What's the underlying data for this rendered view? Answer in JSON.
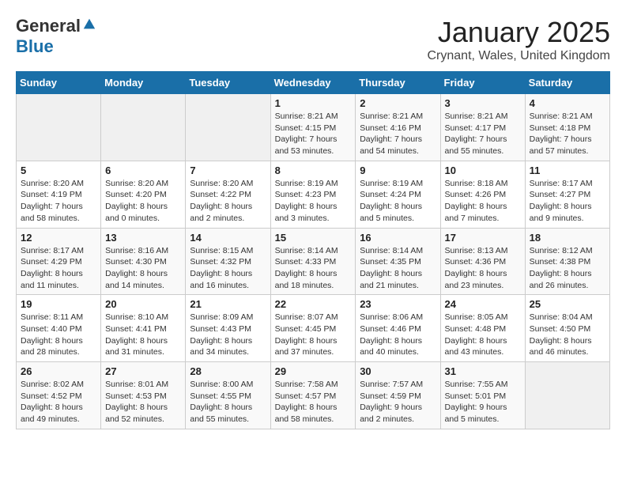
{
  "header": {
    "logo_general": "General",
    "logo_blue": "Blue",
    "title": "January 2025",
    "location": "Crynant, Wales, United Kingdom"
  },
  "days_of_week": [
    "Sunday",
    "Monday",
    "Tuesday",
    "Wednesday",
    "Thursday",
    "Friday",
    "Saturday"
  ],
  "weeks": [
    [
      {
        "day": "",
        "info": ""
      },
      {
        "day": "",
        "info": ""
      },
      {
        "day": "",
        "info": ""
      },
      {
        "day": "1",
        "info": "Sunrise: 8:21 AM\nSunset: 4:15 PM\nDaylight: 7 hours and 53 minutes."
      },
      {
        "day": "2",
        "info": "Sunrise: 8:21 AM\nSunset: 4:16 PM\nDaylight: 7 hours and 54 minutes."
      },
      {
        "day": "3",
        "info": "Sunrise: 8:21 AM\nSunset: 4:17 PM\nDaylight: 7 hours and 55 minutes."
      },
      {
        "day": "4",
        "info": "Sunrise: 8:21 AM\nSunset: 4:18 PM\nDaylight: 7 hours and 57 minutes."
      }
    ],
    [
      {
        "day": "5",
        "info": "Sunrise: 8:20 AM\nSunset: 4:19 PM\nDaylight: 7 hours and 58 minutes."
      },
      {
        "day": "6",
        "info": "Sunrise: 8:20 AM\nSunset: 4:20 PM\nDaylight: 8 hours and 0 minutes."
      },
      {
        "day": "7",
        "info": "Sunrise: 8:20 AM\nSunset: 4:22 PM\nDaylight: 8 hours and 2 minutes."
      },
      {
        "day": "8",
        "info": "Sunrise: 8:19 AM\nSunset: 4:23 PM\nDaylight: 8 hours and 3 minutes."
      },
      {
        "day": "9",
        "info": "Sunrise: 8:19 AM\nSunset: 4:24 PM\nDaylight: 8 hours and 5 minutes."
      },
      {
        "day": "10",
        "info": "Sunrise: 8:18 AM\nSunset: 4:26 PM\nDaylight: 8 hours and 7 minutes."
      },
      {
        "day": "11",
        "info": "Sunrise: 8:17 AM\nSunset: 4:27 PM\nDaylight: 8 hours and 9 minutes."
      }
    ],
    [
      {
        "day": "12",
        "info": "Sunrise: 8:17 AM\nSunset: 4:29 PM\nDaylight: 8 hours and 11 minutes."
      },
      {
        "day": "13",
        "info": "Sunrise: 8:16 AM\nSunset: 4:30 PM\nDaylight: 8 hours and 14 minutes."
      },
      {
        "day": "14",
        "info": "Sunrise: 8:15 AM\nSunset: 4:32 PM\nDaylight: 8 hours and 16 minutes."
      },
      {
        "day": "15",
        "info": "Sunrise: 8:14 AM\nSunset: 4:33 PM\nDaylight: 8 hours and 18 minutes."
      },
      {
        "day": "16",
        "info": "Sunrise: 8:14 AM\nSunset: 4:35 PM\nDaylight: 8 hours and 21 minutes."
      },
      {
        "day": "17",
        "info": "Sunrise: 8:13 AM\nSunset: 4:36 PM\nDaylight: 8 hours and 23 minutes."
      },
      {
        "day": "18",
        "info": "Sunrise: 8:12 AM\nSunset: 4:38 PM\nDaylight: 8 hours and 26 minutes."
      }
    ],
    [
      {
        "day": "19",
        "info": "Sunrise: 8:11 AM\nSunset: 4:40 PM\nDaylight: 8 hours and 28 minutes."
      },
      {
        "day": "20",
        "info": "Sunrise: 8:10 AM\nSunset: 4:41 PM\nDaylight: 8 hours and 31 minutes."
      },
      {
        "day": "21",
        "info": "Sunrise: 8:09 AM\nSunset: 4:43 PM\nDaylight: 8 hours and 34 minutes."
      },
      {
        "day": "22",
        "info": "Sunrise: 8:07 AM\nSunset: 4:45 PM\nDaylight: 8 hours and 37 minutes."
      },
      {
        "day": "23",
        "info": "Sunrise: 8:06 AM\nSunset: 4:46 PM\nDaylight: 8 hours and 40 minutes."
      },
      {
        "day": "24",
        "info": "Sunrise: 8:05 AM\nSunset: 4:48 PM\nDaylight: 8 hours and 43 minutes."
      },
      {
        "day": "25",
        "info": "Sunrise: 8:04 AM\nSunset: 4:50 PM\nDaylight: 8 hours and 46 minutes."
      }
    ],
    [
      {
        "day": "26",
        "info": "Sunrise: 8:02 AM\nSunset: 4:52 PM\nDaylight: 8 hours and 49 minutes."
      },
      {
        "day": "27",
        "info": "Sunrise: 8:01 AM\nSunset: 4:53 PM\nDaylight: 8 hours and 52 minutes."
      },
      {
        "day": "28",
        "info": "Sunrise: 8:00 AM\nSunset: 4:55 PM\nDaylight: 8 hours and 55 minutes."
      },
      {
        "day": "29",
        "info": "Sunrise: 7:58 AM\nSunset: 4:57 PM\nDaylight: 8 hours and 58 minutes."
      },
      {
        "day": "30",
        "info": "Sunrise: 7:57 AM\nSunset: 4:59 PM\nDaylight: 9 hours and 2 minutes."
      },
      {
        "day": "31",
        "info": "Sunrise: 7:55 AM\nSunset: 5:01 PM\nDaylight: 9 hours and 5 minutes."
      },
      {
        "day": "",
        "info": ""
      }
    ]
  ]
}
